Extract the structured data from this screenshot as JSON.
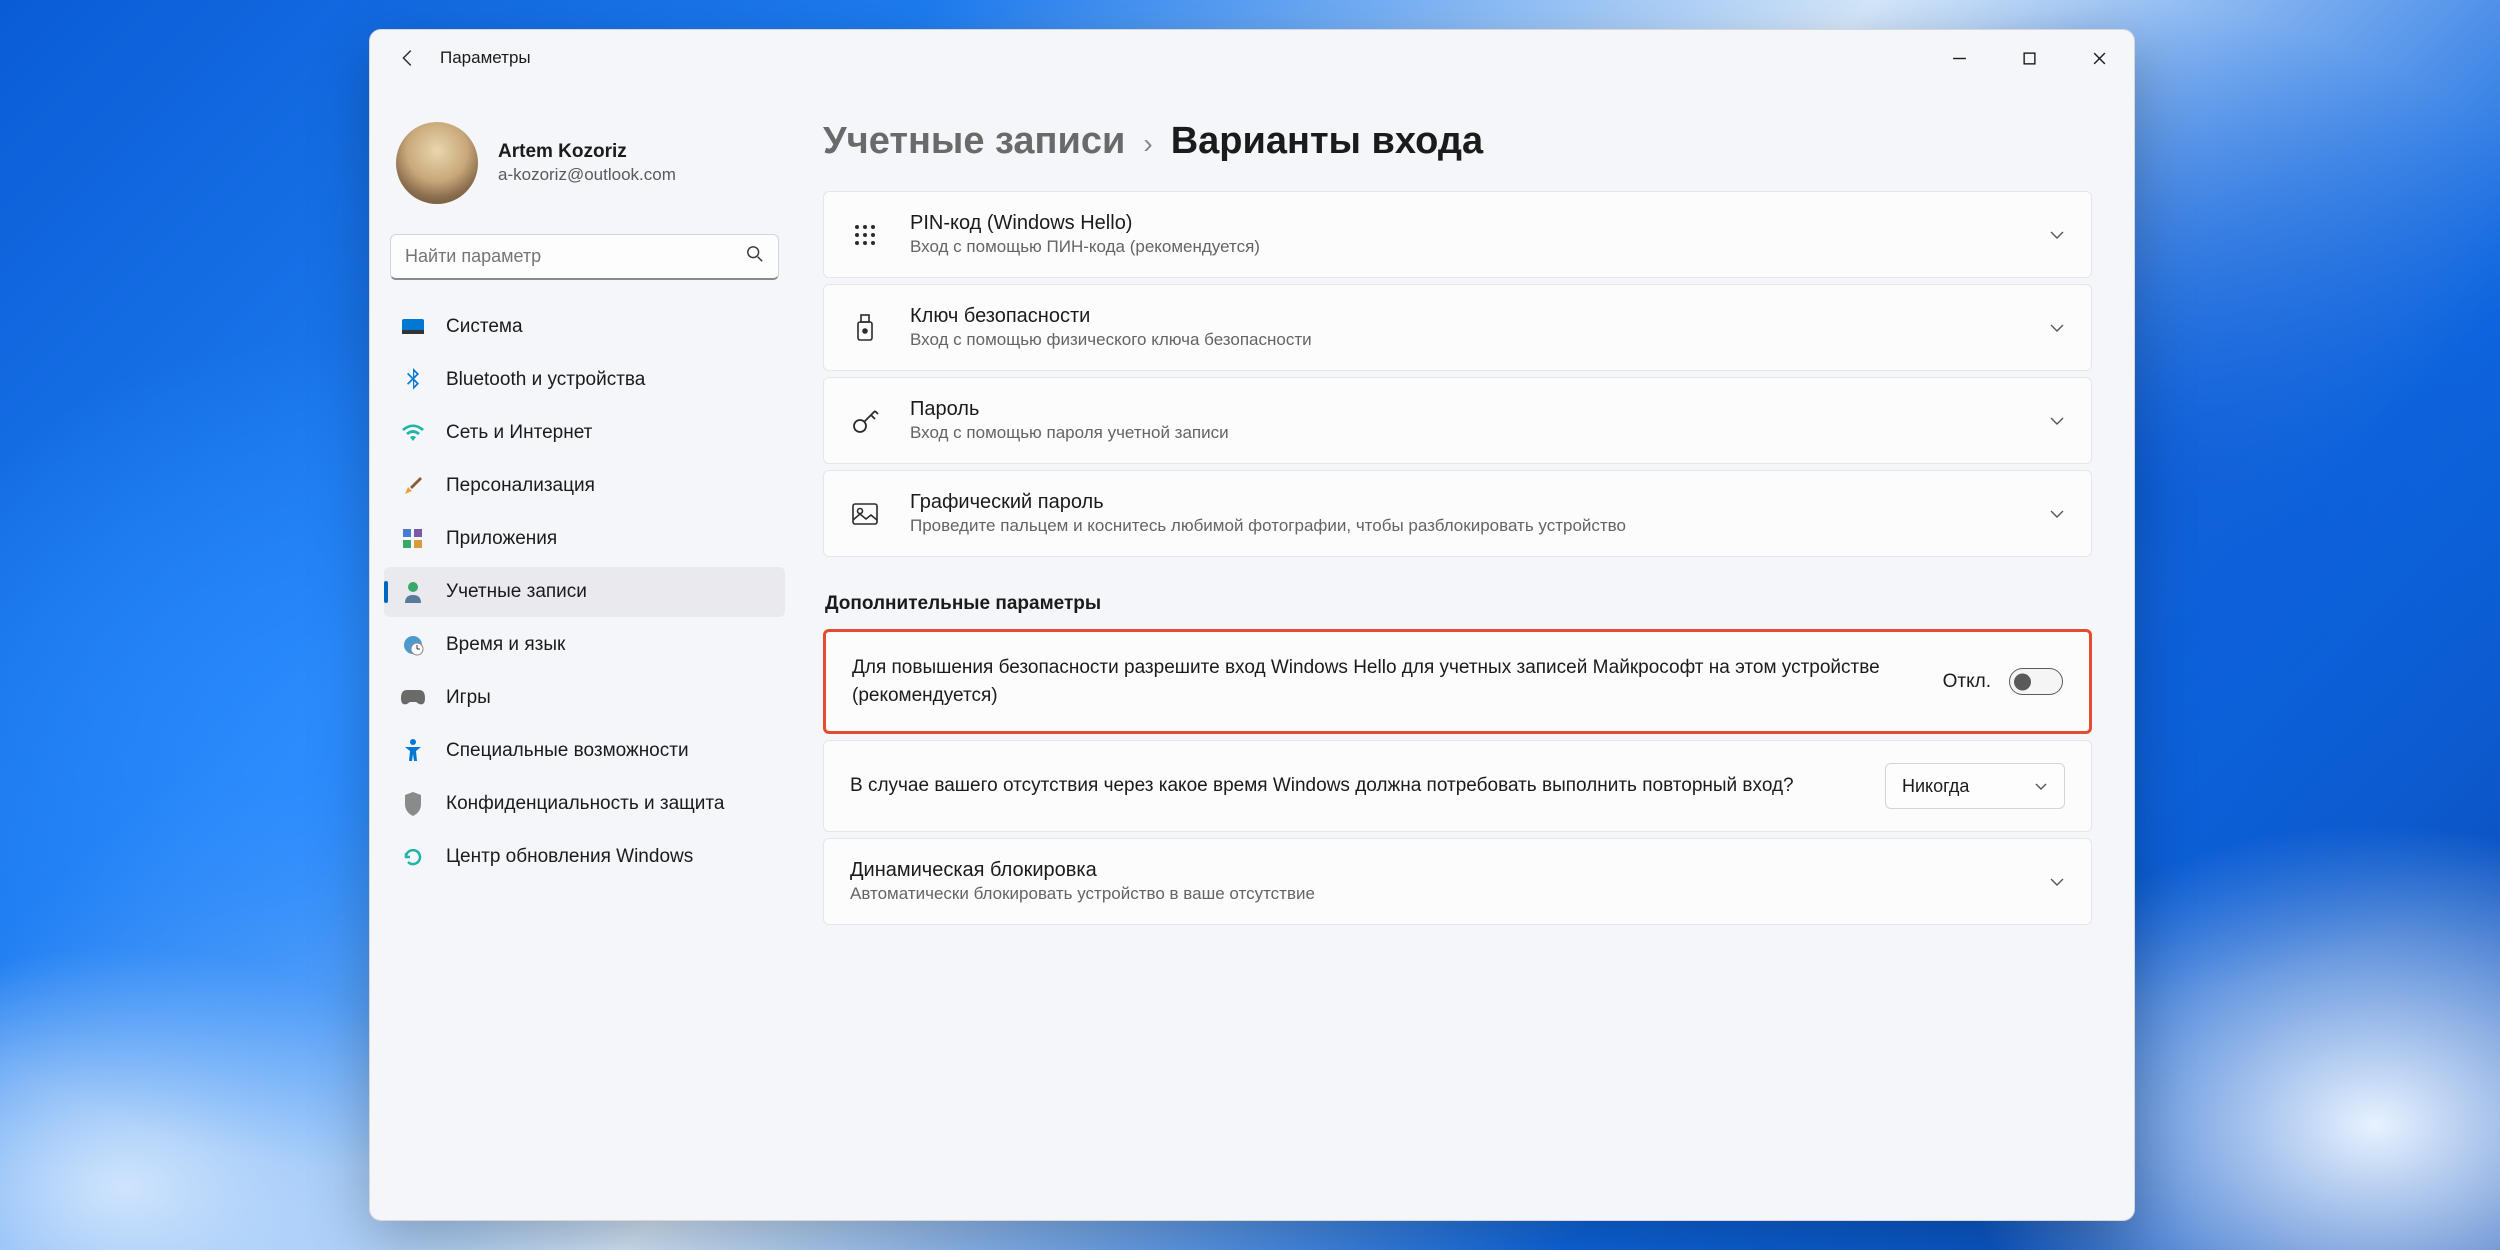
{
  "titlebar": {
    "title": "Параметры"
  },
  "profile": {
    "name": "Artem Kozoriz",
    "email": "a-kozoriz@outlook.com"
  },
  "search": {
    "placeholder": "Найти параметр"
  },
  "sidebar": {
    "items": [
      {
        "label": "Система"
      },
      {
        "label": "Bluetooth и устройства"
      },
      {
        "label": "Сеть и Интернет"
      },
      {
        "label": "Персонализация"
      },
      {
        "label": "Приложения"
      },
      {
        "label": "Учетные записи"
      },
      {
        "label": "Время и язык"
      },
      {
        "label": "Игры"
      },
      {
        "label": "Специальные возможности"
      },
      {
        "label": "Конфиденциальность и защита"
      },
      {
        "label": "Центр обновления Windows"
      }
    ]
  },
  "breadcrumb": {
    "parent": "Учетные записи",
    "current": "Варианты входа"
  },
  "sign_in_options": [
    {
      "title": "PIN-код (Windows Hello)",
      "sub": "Вход с помощью ПИН-кода (рекомендуется)"
    },
    {
      "title": "Ключ безопасности",
      "sub": "Вход с помощью физического ключа безопасности"
    },
    {
      "title": "Пароль",
      "sub": "Вход с помощью пароля учетной записи"
    },
    {
      "title": "Графический пароль",
      "sub": "Проведите пальцем и коснитесь любимой фотографии, чтобы разблокировать устройство"
    }
  ],
  "additional": {
    "heading": "Дополнительные параметры",
    "rows": [
      {
        "text": "Для повышения безопасности разрешите вход Windows Hello для учетных записей Майкрософт на этом устройстве (рекомендуется)",
        "toggle_label": "Откл."
      },
      {
        "text": "В случае вашего отсутствия через какое время Windows должна потребовать выполнить повторный вход?",
        "dropdown_value": "Никогда"
      },
      {
        "title": "Динамическая блокировка",
        "sub": "Автоматически блокировать устройство в ваше отсутствие"
      }
    ]
  }
}
